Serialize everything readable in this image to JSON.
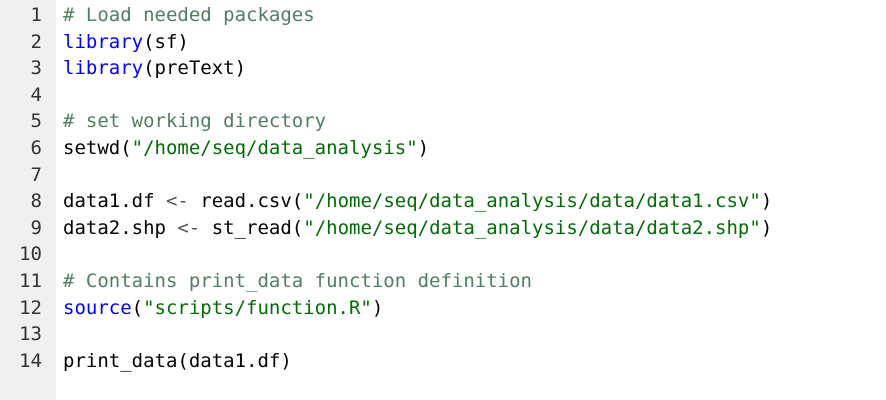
{
  "editor": {
    "colors": {
      "background": "#ffffff",
      "gutter": "#f0f0f0",
      "line_number": "#333333",
      "comment": "#4f7f5f",
      "function": "#0000ff",
      "string": "#036a07",
      "plain": "#000000"
    },
    "lines": [
      {
        "num": "1",
        "tokens": [
          {
            "t": "comment",
            "v": "# Load needed packages"
          }
        ]
      },
      {
        "num": "2",
        "tokens": [
          {
            "t": "fn",
            "v": "library"
          },
          {
            "t": "paren",
            "v": "("
          },
          {
            "t": "plain",
            "v": "sf"
          },
          {
            "t": "paren",
            "v": ")"
          }
        ]
      },
      {
        "num": "3",
        "tokens": [
          {
            "t": "fn",
            "v": "library"
          },
          {
            "t": "paren",
            "v": "("
          },
          {
            "t": "plain",
            "v": "preText"
          },
          {
            "t": "paren",
            "v": ")"
          }
        ]
      },
      {
        "num": "4",
        "tokens": []
      },
      {
        "num": "5",
        "tokens": [
          {
            "t": "comment",
            "v": "# set working directory"
          }
        ]
      },
      {
        "num": "6",
        "tokens": [
          {
            "t": "plain",
            "v": "setwd"
          },
          {
            "t": "paren",
            "v": "("
          },
          {
            "t": "str",
            "v": "\"/home/seq/data_analysis\""
          },
          {
            "t": "paren",
            "v": ")"
          }
        ]
      },
      {
        "num": "7",
        "tokens": []
      },
      {
        "num": "8",
        "tokens": [
          {
            "t": "plain",
            "v": "data1.df "
          },
          {
            "t": "op",
            "v": "<-"
          },
          {
            "t": "plain",
            "v": " read.csv"
          },
          {
            "t": "paren",
            "v": "("
          },
          {
            "t": "str",
            "v": "\"/home/seq/data_analysis/data/data1.csv\""
          },
          {
            "t": "paren",
            "v": ")"
          }
        ]
      },
      {
        "num": "9",
        "tokens": [
          {
            "t": "plain",
            "v": "data2.shp "
          },
          {
            "t": "op",
            "v": "<-"
          },
          {
            "t": "plain",
            "v": " st_read"
          },
          {
            "t": "paren",
            "v": "("
          },
          {
            "t": "str",
            "v": "\"/home/seq/data_analysis/data/data2.shp\""
          },
          {
            "t": "paren",
            "v": ")"
          }
        ]
      },
      {
        "num": "10",
        "tokens": []
      },
      {
        "num": "11",
        "tokens": [
          {
            "t": "comment",
            "v": "# Contains print_data function definition"
          }
        ]
      },
      {
        "num": "12",
        "tokens": [
          {
            "t": "fn",
            "v": "source"
          },
          {
            "t": "paren",
            "v": "("
          },
          {
            "t": "str",
            "v": "\"scripts/function.R\""
          },
          {
            "t": "paren",
            "v": ")"
          }
        ]
      },
      {
        "num": "13",
        "tokens": []
      },
      {
        "num": "14",
        "tokens": [
          {
            "t": "plain",
            "v": "print_data"
          },
          {
            "t": "paren",
            "v": "("
          },
          {
            "t": "plain",
            "v": "data1.df"
          },
          {
            "t": "paren",
            "v": ")"
          }
        ]
      }
    ]
  }
}
